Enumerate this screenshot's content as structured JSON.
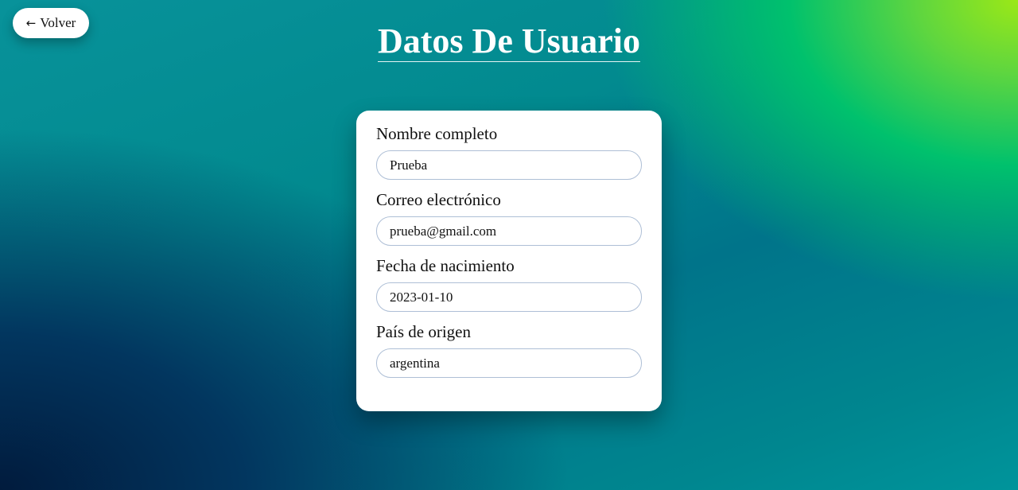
{
  "back_button": {
    "icon": "left-arrow-icon",
    "label": "Volver"
  },
  "page": {
    "title": "Datos De Usuario"
  },
  "form": {
    "fields": [
      {
        "label": "Nombre completo",
        "value": "Prueba"
      },
      {
        "label": "Correo electrónico",
        "value": "prueba@gmail.com"
      },
      {
        "label": "Fecha de nacimiento",
        "value": "2023-01-10"
      },
      {
        "label": "País de origen",
        "value": "argentina"
      }
    ]
  },
  "colors": {
    "gradient_top_right": "#9be817",
    "gradient_green": "#00c16d",
    "gradient_teal": "#028a8f",
    "gradient_bottom_left": "#011b3d",
    "card_background": "#ffffff",
    "input_border": "#aebfd6"
  }
}
